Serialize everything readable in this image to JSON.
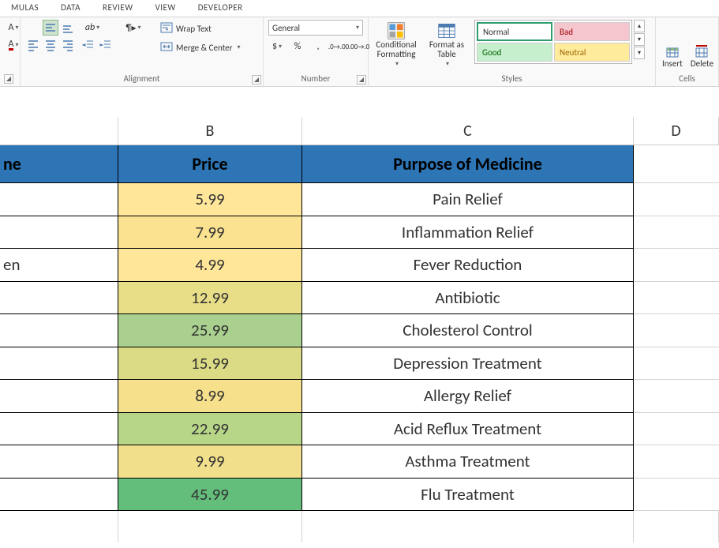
{
  "tabs": {
    "t3": "MULAS",
    "t4": "DATA",
    "t5": "REVIEW",
    "t6": "VIEW",
    "t7": "DEVELOPER"
  },
  "ribbon": {
    "alignment": {
      "label": "Alignment",
      "wrap": "Wrap Text",
      "merge": "Merge & Center"
    },
    "number": {
      "label": "Number",
      "format": "General",
      "currency": "$",
      "percent": "%",
      "comma": ","
    },
    "styles": {
      "label": "Styles",
      "conditional": "Conditional Formatting",
      "formatas": "Format as Table",
      "normal": "Normal",
      "bad": "Bad",
      "good": "Good",
      "neutral": "Neutral"
    },
    "cells": {
      "label": "Cells",
      "insert": "Insert",
      "delete": "Delete"
    }
  },
  "columns": {
    "A": "",
    "B": "B",
    "C": "C",
    "D": "D"
  },
  "header": {
    "a": "ne",
    "b": "Price",
    "c": "Purpose of Medicine"
  },
  "rows": [
    {
      "a": "",
      "b": "5.99",
      "c": "Pain Relief",
      "bcolor": "#FFE699"
    },
    {
      "a": "",
      "b": "7.99",
      "c": "Inflammation Relief",
      "bcolor": "#FAE290"
    },
    {
      "a": "en",
      "b": "4.99",
      "c": "Fever Reduction",
      "bcolor": "#FFE699"
    },
    {
      "a": "",
      "b": "12.99",
      "c": "Antibiotic",
      "bcolor": "#E8DE87"
    },
    {
      "a": "",
      "b": "25.99",
      "c": "Cholesterol Control",
      "bcolor": "#A9D08E"
    },
    {
      "a": "",
      "b": "15.99",
      "c": "Depression Treatment",
      "bcolor": "#DBDB85"
    },
    {
      "a": "",
      "b": "8.99",
      "c": "Allergy Relief",
      "bcolor": "#F6E08B"
    },
    {
      "a": "",
      "b": "22.99",
      "c": "Acid Reflux Treatment",
      "bcolor": "#B8D688"
    },
    {
      "a": "",
      "b": "9.99",
      "c": "Asthma Treatment",
      "bcolor": "#F2DF8B"
    },
    {
      "a": "",
      "b": "45.99",
      "c": "Flu Treatment",
      "bcolor": "#63BE7B"
    }
  ]
}
